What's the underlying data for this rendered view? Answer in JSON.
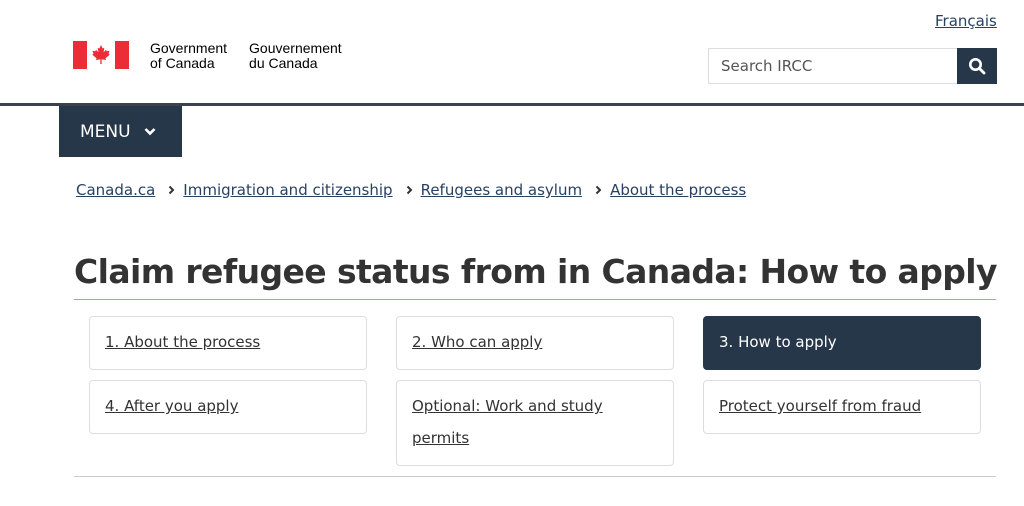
{
  "header": {
    "language_link": "Français",
    "brand": {
      "en_line1": "Government",
      "en_line2": "of Canada",
      "fr_line1": "Gouvernement",
      "fr_line2": "du Canada",
      "flag_icon": "canada-flag-icon",
      "flag_color": "#eb2d37"
    },
    "search": {
      "placeholder": "Search IRCC",
      "value": "",
      "button_icon": "search-icon"
    },
    "menu_label": "MENU",
    "menu_icon": "chevron-down-icon",
    "accent_color": "#26374a"
  },
  "breadcrumb": [
    {
      "label": "Canada.ca"
    },
    {
      "label": "Immigration and citizenship"
    },
    {
      "label": "Refugees and asylum"
    },
    {
      "label": "About the process"
    }
  ],
  "page": {
    "title": "Claim refugee status from in Canada: How to apply"
  },
  "steps": [
    {
      "label": "1. About the process",
      "active": false
    },
    {
      "label": "2. Who can apply",
      "active": false
    },
    {
      "label": "3. How to apply",
      "active": true
    },
    {
      "label": "4. After you apply",
      "active": false
    },
    {
      "label": "Optional: Work and study permits",
      "active": false
    },
    {
      "label": "Protect yourself from fraud",
      "active": false
    }
  ]
}
